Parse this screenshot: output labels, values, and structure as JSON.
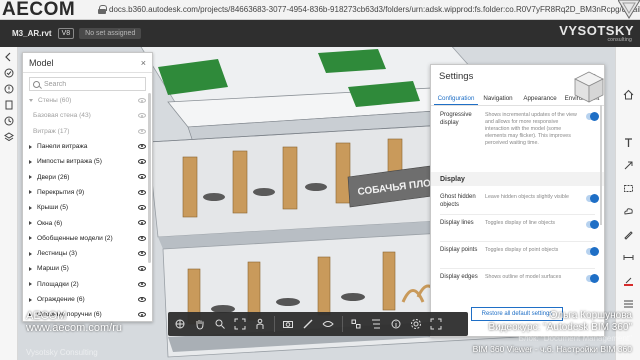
{
  "browser": {
    "brand": "AECOM",
    "url_prefix": "docs.b360.autodesk.com/projects/84663683-3077-4954-836b-918273cb63d3/folders/urn:adsk.wipprod:fs.folder:co.R0V7yFR8Rq2D_BM3nRcpg/detail/viewer/items/urn:adsk.wipprod:dm.lineage:Y..."
  },
  "app": {
    "file_name": "M3_AR.rvt",
    "version_badge": "V8",
    "assign_button": "No set assigned",
    "watermark_logo": "VYSOTSKY",
    "watermark_sub": "consulting"
  },
  "model_panel": {
    "title": "Model",
    "close": "×",
    "search_placeholder": "Search",
    "items": [
      {
        "label": "Стены (60)",
        "state": "expanded",
        "dim": true
      },
      {
        "label": "Базовая стена (43)",
        "state": "child",
        "dim": true
      },
      {
        "label": "Витраж (17)",
        "state": "child",
        "dim": true
      },
      {
        "label": "Панели витража",
        "state": "collapsed",
        "dim": false
      },
      {
        "label": "Импосты витража (5)",
        "state": "collapsed",
        "dim": false
      },
      {
        "label": "Двери (26)",
        "state": "collapsed",
        "dim": false
      },
      {
        "label": "Перекрытия (9)",
        "state": "collapsed",
        "dim": false
      },
      {
        "label": "Крыши (5)",
        "state": "collapsed",
        "dim": false
      },
      {
        "label": "Окна (6)",
        "state": "collapsed",
        "dim": false
      },
      {
        "label": "Обобщенные модели (2)",
        "state": "collapsed",
        "dim": false
      },
      {
        "label": "Лестницы (3)",
        "state": "collapsed",
        "dim": false
      },
      {
        "label": "Марши (5)",
        "state": "collapsed",
        "dim": false
      },
      {
        "label": "Площадки (2)",
        "state": "collapsed",
        "dim": false
      },
      {
        "label": "Ограждение (6)",
        "state": "collapsed",
        "dim": false
      },
      {
        "label": "Опорные поручни (6)",
        "state": "collapsed",
        "dim": false
      }
    ]
  },
  "settings": {
    "title": "Settings",
    "close": "×",
    "tabs": [
      "Configuration",
      "Navigation",
      "Appearance",
      "Environment"
    ],
    "active_tab": "Configuration",
    "options": [
      {
        "label": "Progressive display",
        "desc": "Shows incremental updates of the view and allows for more responsive interaction with the model (some elements may flicker). This improves perceived waiting time.",
        "on": true
      }
    ],
    "section_display": "Display",
    "display_options": [
      {
        "label": "Ghost hidden objects",
        "desc": "Leave hidden objects slightly visible",
        "on": true
      },
      {
        "label": "Display lines",
        "desc": "Toggles display of line objects",
        "on": true
      },
      {
        "label": "Display points",
        "desc": "Toggles display of point objects",
        "on": true
      },
      {
        "label": "Display edges",
        "desc": "Shows outline of model surfaces",
        "on": true
      }
    ],
    "restore_button": "Restore all default settings"
  },
  "scene": {
    "sign_text": "СОБАЧЬЯ ПЛОЩАДКА"
  },
  "overlay": {
    "left_line1": "AECOM",
    "left_line2": "www.aecom.com/ru",
    "left_faint": "Vysotsky Consulting",
    "right_line1": "Ольга Коршунова",
    "right_line2": "Видеокурс: \"Autodesk BIM 360\"",
    "right_line3": "Блок: \"Document Management\"",
    "right_line4": "BIM 360 Viewer - ч.6. Настройки BIM 360"
  },
  "colors": {
    "accent_blue": "#1f6fc6",
    "app_header": "#2f2f2f",
    "roof_green": "#2f8a3a"
  }
}
